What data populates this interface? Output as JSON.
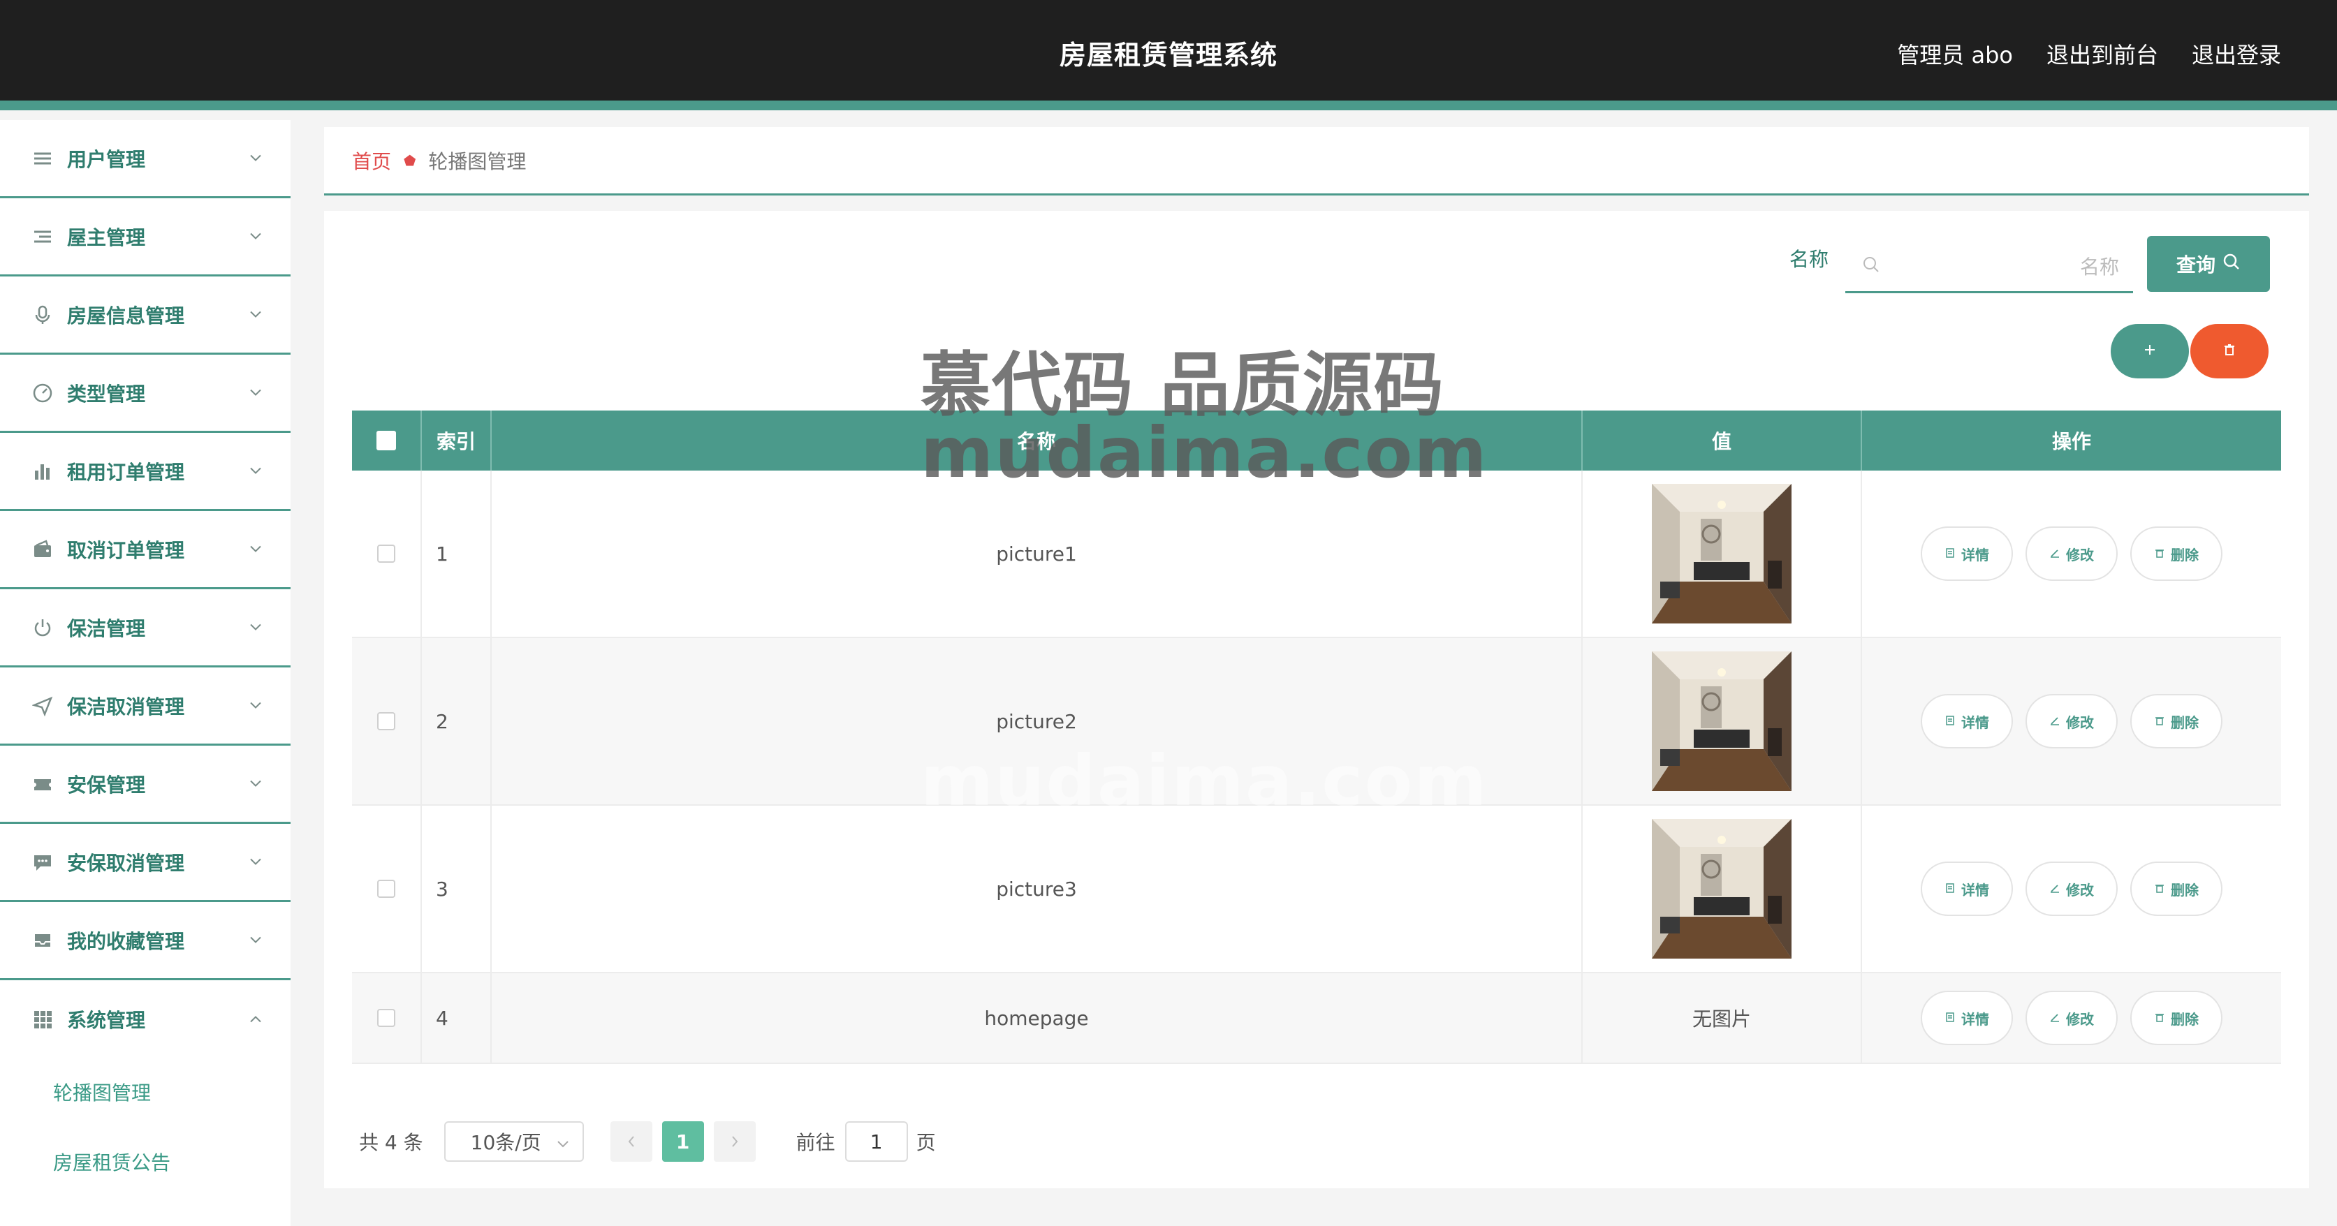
{
  "header": {
    "title": "房屋租赁管理系统",
    "user": "管理员 abo",
    "front": "退出到前台",
    "logout": "退出登录"
  },
  "sidebar": {
    "items": [
      {
        "label": "用户管理",
        "icon": "list-icon"
      },
      {
        "label": "屋主管理",
        "icon": "list-indent-icon"
      },
      {
        "label": "房屋信息管理",
        "icon": "microphone-icon"
      },
      {
        "label": "类型管理",
        "icon": "dashboard-icon"
      },
      {
        "label": "租用订单管理",
        "icon": "bar-chart-icon"
      },
      {
        "label": "取消订单管理",
        "icon": "wallet-icon"
      },
      {
        "label": "保洁管理",
        "icon": "power-icon"
      },
      {
        "label": "保洁取消管理",
        "icon": "send-icon"
      },
      {
        "label": "安保管理",
        "icon": "ticket-icon"
      },
      {
        "label": "安保取消管理",
        "icon": "message-icon"
      },
      {
        "label": "我的收藏管理",
        "icon": "inbox-icon"
      },
      {
        "label": "系统管理",
        "icon": "grid-icon"
      }
    ],
    "subitems": [
      "轮播图管理",
      "房屋租赁公告"
    ]
  },
  "breadcrumb": {
    "home": "首页",
    "current": "轮播图管理"
  },
  "search": {
    "label": "名称",
    "placeholder": "名称",
    "value": "",
    "button": "查询"
  },
  "table": {
    "headers": [
      "索引",
      "名称",
      "值",
      "操作"
    ],
    "rows": [
      {
        "index": "1",
        "name": "picture1",
        "value": "",
        "has_image": true
      },
      {
        "index": "2",
        "name": "picture2",
        "value": "",
        "has_image": true
      },
      {
        "index": "3",
        "name": "picture3",
        "value": "",
        "has_image": true
      },
      {
        "index": "4",
        "name": "homepage",
        "value": "无图片",
        "has_image": false
      }
    ],
    "actions": {
      "detail": "详情",
      "edit": "修改",
      "delete": "删除"
    }
  },
  "pagination": {
    "total": "共 4 条",
    "size": "10条/页",
    "current_page": "1",
    "goto_prefix": "前往",
    "goto_value": "1",
    "goto_suffix": "页"
  },
  "watermark": {
    "line1": "慕代码 品质源码",
    "line2": "mudaima.com",
    "line3": "mudaima.com"
  },
  "colors": {
    "accent": "#4b9a8b",
    "danger": "#ef5a2f",
    "header_bg": "#1f1f1f",
    "page_active": "#5fbea0"
  }
}
